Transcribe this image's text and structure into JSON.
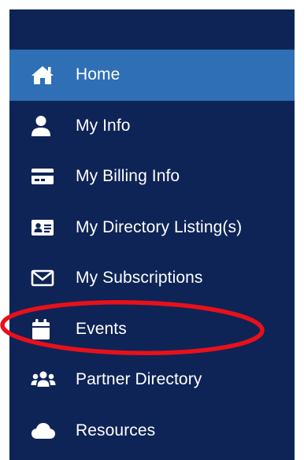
{
  "sidebar": {
    "background": "#0e2456",
    "active_color": "#2f6fb5",
    "items": [
      {
        "label": "Home",
        "icon": "home-icon",
        "active": true
      },
      {
        "label": "My Info",
        "icon": "user-icon",
        "active": false
      },
      {
        "label": "My Billing Info",
        "icon": "credit-card-icon",
        "active": false
      },
      {
        "label": "My Directory Listing(s)",
        "icon": "id-card-icon",
        "active": false
      },
      {
        "label": "My Subscriptions",
        "icon": "envelope-icon",
        "active": false
      },
      {
        "label": "Events",
        "icon": "calendar-icon",
        "active": false
      },
      {
        "label": "Partner Directory",
        "icon": "users-icon",
        "active": false
      },
      {
        "label": "Resources",
        "icon": "cloud-icon",
        "active": false
      }
    ]
  },
  "annotation": {
    "color": "#e8101a",
    "target": "Events"
  }
}
